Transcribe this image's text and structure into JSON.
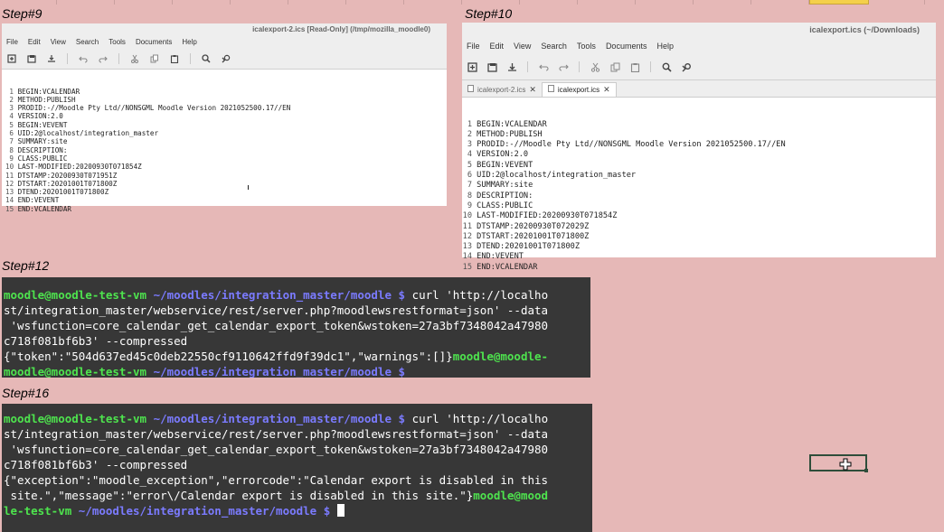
{
  "steps": {
    "step9": "Step#9",
    "step10": "Step#10",
    "step12": "Step#12",
    "step16": "Step#16"
  },
  "editor_left": {
    "title": "icalexport-2.ics [Read-Only] (/tmp/mozilla_moodle0)",
    "menus": [
      "File",
      "Edit",
      "View",
      "Search",
      "Tools",
      "Documents",
      "Help"
    ],
    "lines": [
      {
        "n": "1",
        "t": "BEGIN:VCALENDAR"
      },
      {
        "n": "2",
        "t": "METHOD:PUBLISH"
      },
      {
        "n": "3",
        "t": "PRODID:-//Moodle Pty Ltd//NONSGML Moodle Version 2021052500.17//EN"
      },
      {
        "n": "4",
        "t": "VERSION:2.0"
      },
      {
        "n": "5",
        "t": "BEGIN:VEVENT"
      },
      {
        "n": "6",
        "t": "UID:2@localhost/integration_master"
      },
      {
        "n": "7",
        "t": "SUMMARY:site"
      },
      {
        "n": "8",
        "t": "DESCRIPTION:"
      },
      {
        "n": "9",
        "t": "CLASS:PUBLIC"
      },
      {
        "n": "10",
        "t": "LAST-MODIFIED:20200930T071854Z"
      },
      {
        "n": "11",
        "t": "DTSTAMP:20200930T071951Z"
      },
      {
        "n": "12",
        "t": "DTSTART:20201001T071800Z"
      },
      {
        "n": "13",
        "t": "DTEND:20201001T071800Z"
      },
      {
        "n": "14",
        "t": "END:VEVENT"
      },
      {
        "n": "15",
        "t": "END:VCALENDAR"
      }
    ]
  },
  "editor_right": {
    "title": "icalexport.ics (~/Downloads)",
    "menus": [
      "File",
      "Edit",
      "View",
      "Search",
      "Tools",
      "Documents",
      "Help"
    ],
    "tabs": [
      {
        "label": "icalexport-2.ics",
        "active": false
      },
      {
        "label": "icalexport.ics",
        "active": true
      }
    ],
    "lines": [
      {
        "n": "1",
        "t": "BEGIN:VCALENDAR"
      },
      {
        "n": "2",
        "t": "METHOD:PUBLISH"
      },
      {
        "n": "3",
        "t": "PRODID:-//Moodle Pty Ltd//NONSGML Moodle Version 2021052500.17//EN"
      },
      {
        "n": "4",
        "t": "VERSION:2.0"
      },
      {
        "n": "5",
        "t": "BEGIN:VEVENT"
      },
      {
        "n": "6",
        "t": "UID:2@localhost/integration_master"
      },
      {
        "n": "7",
        "t": "SUMMARY:site"
      },
      {
        "n": "8",
        "t": "DESCRIPTION:"
      },
      {
        "n": "9",
        "t": "CLASS:PUBLIC"
      },
      {
        "n": "10",
        "t": "LAST-MODIFIED:20200930T071854Z"
      },
      {
        "n": "11",
        "t": "DTSTAMP:20200930T072029Z"
      },
      {
        "n": "12",
        "t": "DTSTART:20201001T071800Z"
      },
      {
        "n": "13",
        "t": "DTEND:20201001T071800Z"
      },
      {
        "n": "14",
        "t": "END:VEVENT"
      },
      {
        "n": "15",
        "t": "END:VCALENDAR"
      }
    ]
  },
  "term12": {
    "user": "moodle@moodle-test-vm",
    "path": "~/moodles/integration_master/moodle",
    "dollar": "$",
    "cmd1": "curl 'http://localho",
    "l2": "st/integration_master/webservice/rest/server.php?moodlewsrestformat=json' --data",
    "l3": " 'wsfunction=core_calendar_get_calendar_export_token&wstoken=27a3bf7348042a47980",
    "l4": "c718f081bf6b3' --compressed",
    "l5_out": "{\"token\":\"504d637ed45c0deb22550cf9110642ffd9f39dc1\",\"warnings\":[]}",
    "l5_user": "moodle@moodle-",
    "l6_user": "moodle@moodle-test-vm",
    "l6_path": "~/moodles/integration_master/moodle",
    "l6_dollar": "$"
  },
  "term16": {
    "user": "moodle@moodle-test-vm",
    "path": "~/moodles/integration_master/moodle",
    "dollar": "$",
    "cmd1": "curl 'http://localho",
    "l2": "st/integration_master/webservice/rest/server.php?moodlewsrestformat=json' --data",
    "l3": " 'wsfunction=core_calendar_get_calendar_export_token&wstoken=27a3bf7348042a47980",
    "l4": "c718f081bf6b3' --compressed",
    "l5": "{\"exception\":\"moodle_exception\",\"errorcode\":\"Calendar export is disabled in this",
    "l6_out": " site.\",\"message\":\"error\\/Calendar export is disabled in this site.\"}",
    "l6_user": "moodle@mood",
    "l7_user": "le-test-vm",
    "l7_path": "~/moodles/integration_master/moodle",
    "l7_dollar": "$"
  }
}
